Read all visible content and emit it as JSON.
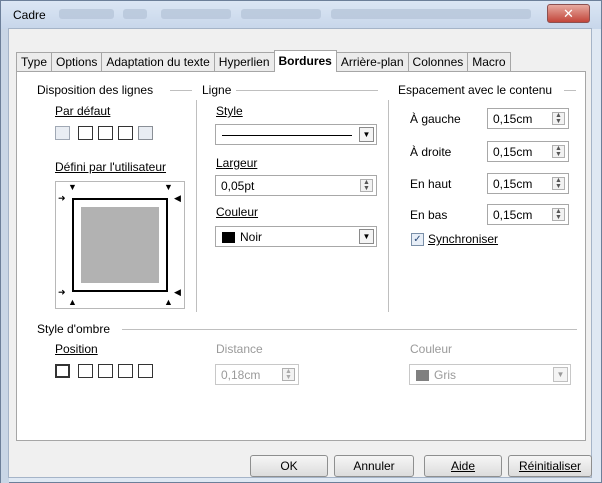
{
  "window": {
    "title": "Cadre",
    "close_glyph": "✕"
  },
  "tabs": [
    {
      "label": "Type"
    },
    {
      "label": "Options"
    },
    {
      "label": "Adaptation du texte"
    },
    {
      "label": "Hyperlien"
    },
    {
      "label": "Bordures"
    },
    {
      "label": "Arrière-plan"
    },
    {
      "label": "Colonnes"
    },
    {
      "label": "Macro"
    }
  ],
  "active_tab": "Bordures",
  "line_arrangement": {
    "group_label": "Disposition des lignes",
    "default_label": "Par défaut",
    "user_defined_label": "Défini par l'utilisateur"
  },
  "line": {
    "group_label": "Ligne",
    "style_label": "Style",
    "width_label": "Largeur",
    "width_value": "0,05pt",
    "color_label": "Couleur",
    "color_value": "Noir",
    "color_swatch": "#000000"
  },
  "spacing": {
    "group_label": "Espacement avec le contenu",
    "rows": [
      {
        "label": "À gauche",
        "value": "0,15cm"
      },
      {
        "label": "À droite",
        "value": "0,15cm"
      },
      {
        "label": "En haut",
        "value": "0,15cm"
      },
      {
        "label": "En bas",
        "value": "0,15cm"
      }
    ],
    "sync_label": "Synchroniser",
    "sync_checked": true
  },
  "shadow": {
    "group_label": "Style d'ombre",
    "position_label": "Position",
    "distance_label": "Distance",
    "distance_value": "0,18cm",
    "color_label": "Couleur",
    "color_value": "Gris",
    "color_swatch": "#808080"
  },
  "buttons": {
    "ok": "OK",
    "cancel": "Annuler",
    "help": "Aide",
    "reset": "Réinitialiser"
  }
}
